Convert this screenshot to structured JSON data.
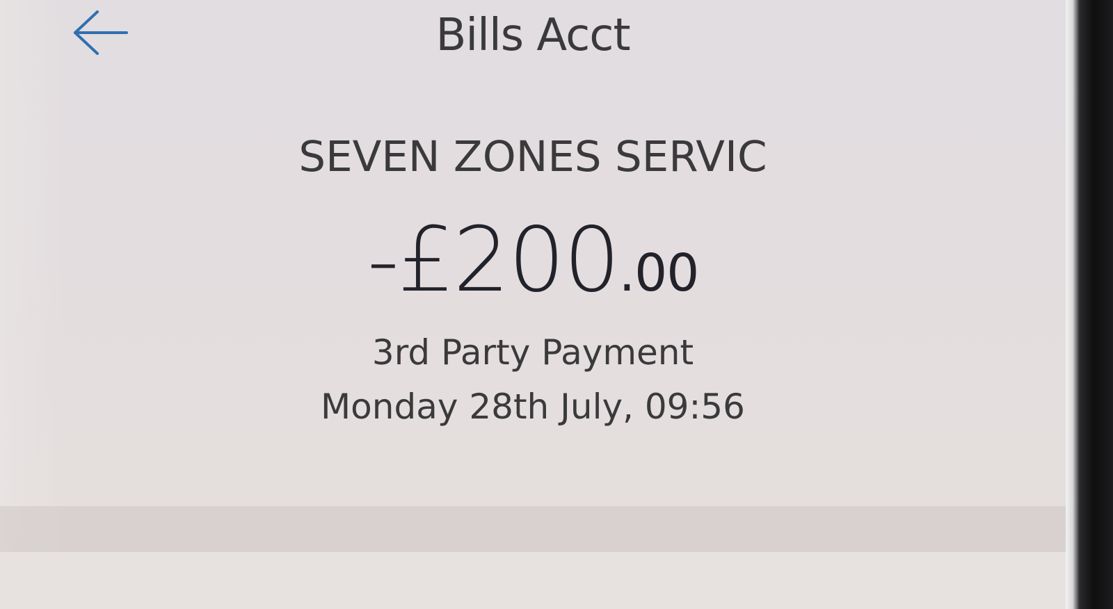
{
  "header": {
    "title": "Bills Acct",
    "back_icon": "arrow-left-icon",
    "accent_color": "#2f6fb0"
  },
  "transaction": {
    "merchant": "SEVEN ZONES SERVIC",
    "amount_main": "-£200",
    "amount_decimal": ".00",
    "type": "3rd Party Payment",
    "datetime": "Monday 28th July, 09:56"
  }
}
